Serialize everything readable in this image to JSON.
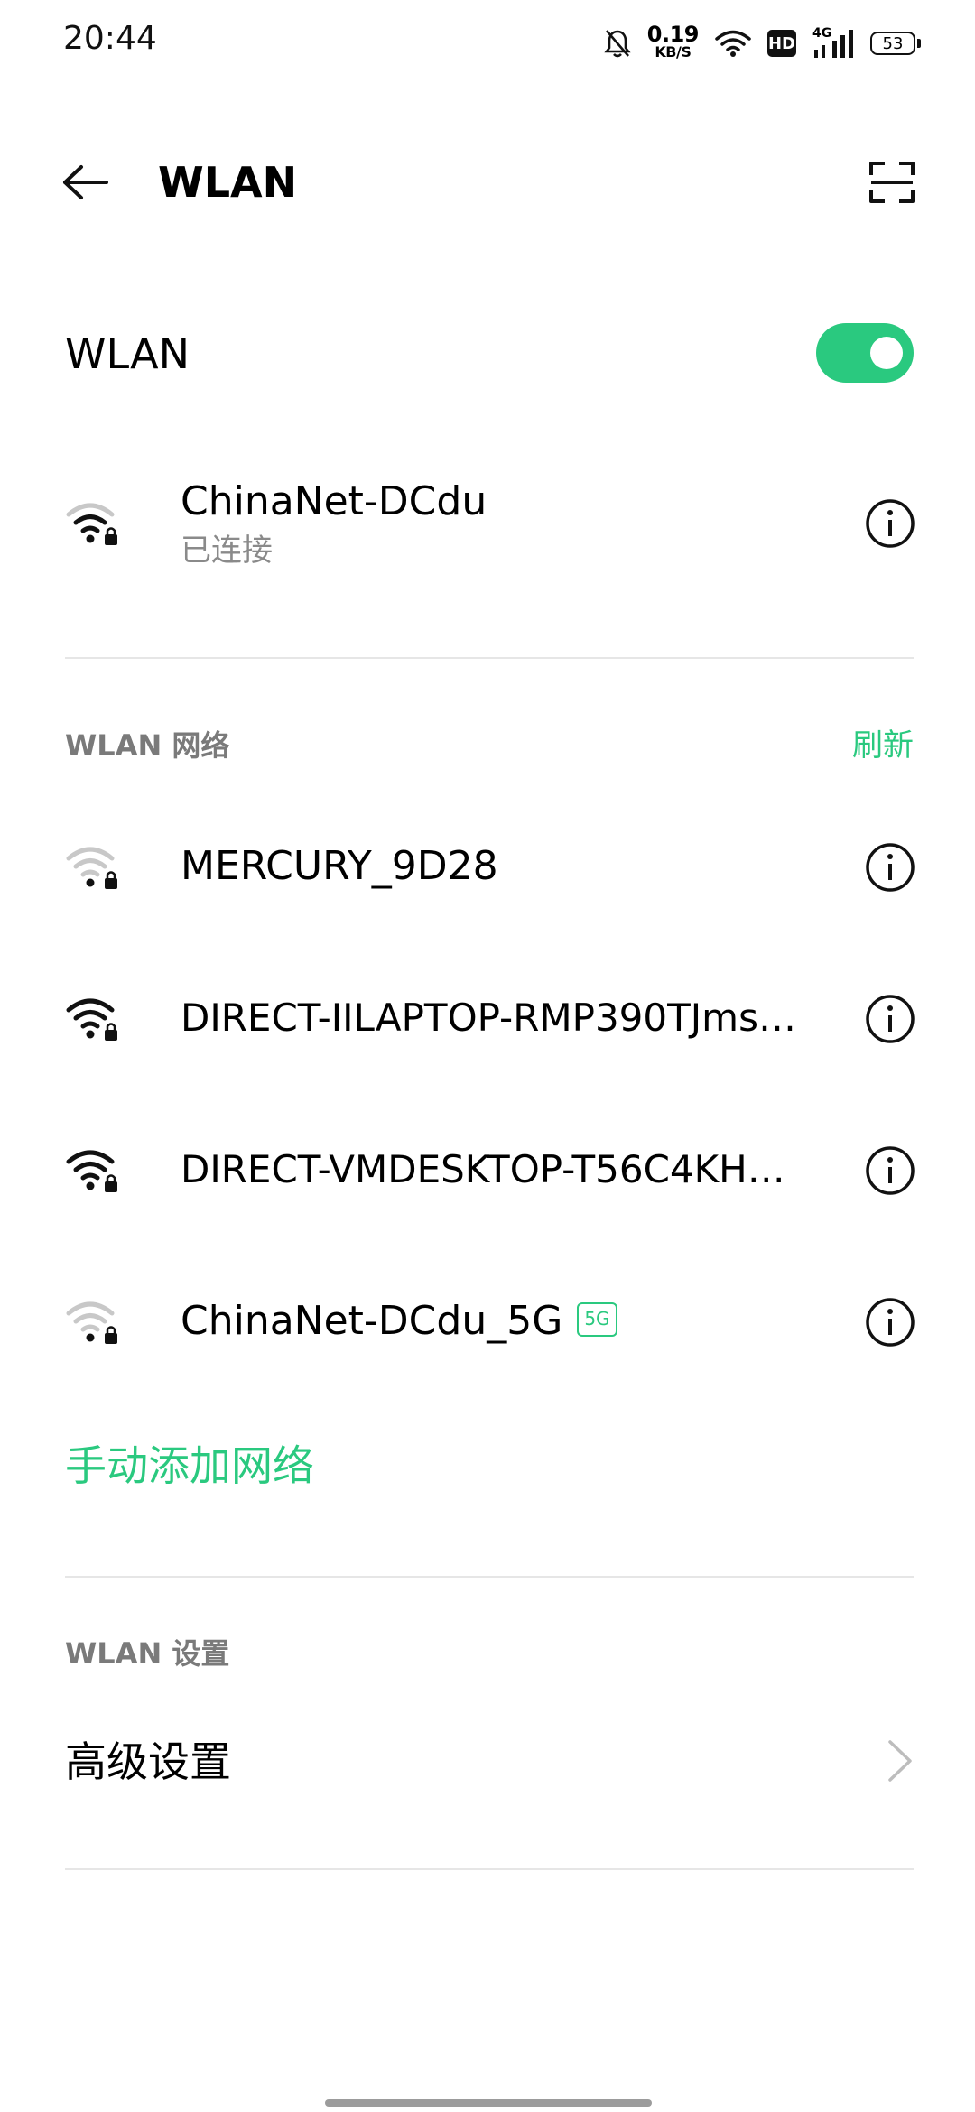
{
  "status_bar": {
    "time": "20:44",
    "speed_value": "0.19",
    "speed_unit": "KB/S",
    "hd": "HD",
    "network_type": "4G",
    "battery": "53",
    "icons": [
      "bell-off-icon",
      "wifi-icon",
      "hd-icon",
      "cellular-signal-icon",
      "battery-icon"
    ]
  },
  "toolbar": {
    "title": "WLAN",
    "back_icon": "back-arrow-icon",
    "scan_icon": "qr-scan-icon"
  },
  "wlan_toggle": {
    "label": "WLAN",
    "enabled": true,
    "accent_color": "#2ac97f"
  },
  "connected_network": {
    "name": "ChinaNet-DCdu",
    "status": "已连接",
    "signal": "medium",
    "locked": true
  },
  "available_networks": {
    "header": "WLAN 网络",
    "refresh_label": "刷新",
    "items": [
      {
        "name": "MERCURY_9D28",
        "signal": "weak",
        "locked": true,
        "badge": ""
      },
      {
        "name": "DIRECT-IILAPTOP-RMP390TJms…",
        "signal": "strong",
        "locked": true,
        "badge": ""
      },
      {
        "name": "DIRECT-VMDESKTOP-T56C4KH…",
        "signal": "strong",
        "locked": true,
        "badge": ""
      },
      {
        "name": "ChinaNet-DCdu_5G",
        "signal": "weak",
        "locked": true,
        "badge": "5G"
      }
    ]
  },
  "add_network_label": "手动添加网络",
  "settings_section": {
    "header": "WLAN 设置",
    "advanced_label": "高级设置"
  }
}
